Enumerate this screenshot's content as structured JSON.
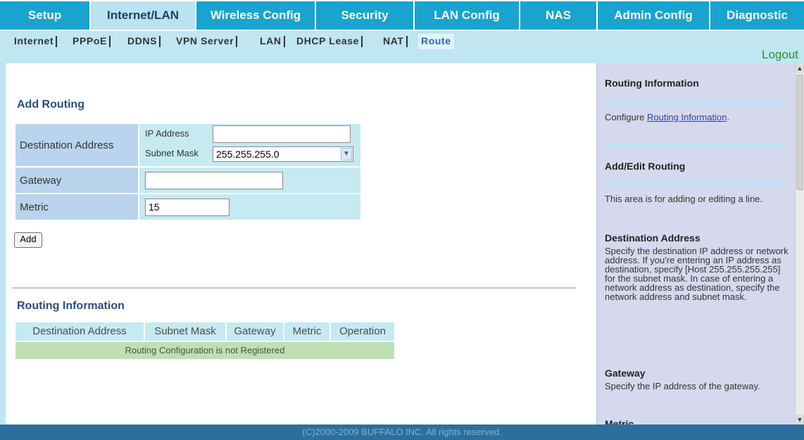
{
  "topnav": {
    "tabs": [
      "Setup",
      "Internet/LAN",
      "Wireless Config",
      "Security",
      "LAN Config",
      "NAS",
      "Admin Config",
      "Diagnostic"
    ]
  },
  "subnav": {
    "items": [
      "Internet",
      "PPPoE",
      "DDNS",
      "VPN Server",
      "LAN",
      "DHCP Lease",
      "NAT",
      "Route"
    ],
    "logout": "Logout"
  },
  "add_routing": {
    "title": "Add Routing",
    "destination_label": "Destination Address",
    "ip_label": "IP Address",
    "ip_value": "",
    "subnet_label": "Subnet Mask",
    "subnet_value": "255.255.255.0",
    "gateway_label": "Gateway",
    "gateway_value": "",
    "metric_label": "Metric",
    "metric_value": "15",
    "add_button": "Add"
  },
  "routing_info": {
    "title": "Routing Information",
    "columns": [
      "Destination Address",
      "Subnet Mask",
      "Gateway",
      "Metric",
      "Operation"
    ],
    "empty_message": "Routing Configuration is not Registered"
  },
  "help": {
    "h1": "Routing Information",
    "p1_prefix": "Configure ",
    "p1_link": "Routing Information",
    "p1_suffix": ".",
    "h2": "Add/Edit Routing",
    "p2": "This area is for adding or editing a line.",
    "h3": "Destination Address",
    "p3": "Specify the destination IP address or network address. If you're entering an IP address as destination, specify [Host 255.255.255.255] for the subnet mask. In case of entering a network address as destination, specify the network address and subnet mask.",
    "h4": "Gateway",
    "p4": "Specify the IP address of the gateway.",
    "h5": "Metric"
  },
  "footer": {
    "text": "(C)2000-2009 BUFFALO INC. All rights reserved."
  }
}
